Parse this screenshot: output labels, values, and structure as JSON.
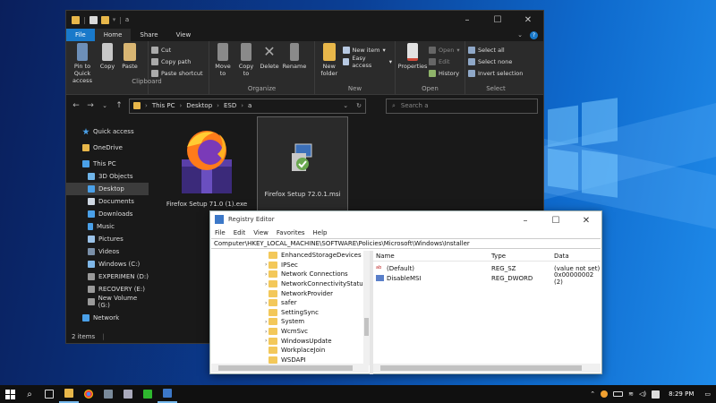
{
  "explorer": {
    "tabs": [
      "File",
      "Home",
      "Share",
      "View"
    ],
    "ribbon": {
      "clipboard": {
        "pin": "Pin to Quick access",
        "copy": "Copy",
        "paste": "Paste",
        "cut": "Cut",
        "copy_path": "Copy path",
        "paste_shortcut": "Paste shortcut",
        "label": "Clipboard"
      },
      "organize": {
        "move": "Move to",
        "copy_to": "Copy to",
        "delete": "Delete",
        "rename": "Rename",
        "label": "Organize"
      },
      "new": {
        "new_folder": "New folder",
        "new_item": "New item",
        "easy_access": "Easy access",
        "label": "New"
      },
      "open": {
        "properties": "Properties",
        "open": "Open",
        "edit": "Edit",
        "history": "History",
        "label": "Open"
      },
      "select": {
        "select_all": "Select all",
        "select_none": "Select none",
        "invert": "Invert selection",
        "label": "Select"
      }
    },
    "breadcrumb": [
      "This PC",
      "Desktop",
      "ESD",
      "a"
    ],
    "search_placeholder": "Search a",
    "nav": {
      "quick_access": "Quick access",
      "onedrive": "OneDrive",
      "this_pc": "This PC",
      "objects3d": "3D Objects",
      "desktop": "Desktop",
      "documents": "Documents",
      "downloads": "Downloads",
      "music": "Music",
      "pictures": "Pictures",
      "videos": "Videos",
      "windows_c": "Windows (C:)",
      "experimen_d": "EXPERIMEN (D:)",
      "recovery_e": "RECOVERY (E:)",
      "newvol_g": "New Volume (G:)",
      "network": "Network"
    },
    "files": [
      {
        "name": "Firefox Setup 71.0 (1).exe"
      },
      {
        "name": "Firefox Setup 72.0.1.msi"
      }
    ],
    "status": "2 items"
  },
  "regedit": {
    "title": "Registry Editor",
    "menu": [
      "File",
      "Edit",
      "View",
      "Favorites",
      "Help"
    ],
    "path": "Computer\\HKEY_LOCAL_MACHINE\\SOFTWARE\\Policies\\Microsoft\\Windows\\Installer",
    "tree": [
      "EnhancedStorageDevices",
      "IPSec",
      "Network Connections",
      "NetworkConnectivityStatu",
      "NetworkProvider",
      "safer",
      "SettingSync",
      "System",
      "WcmSvc",
      "WindowsUpdate",
      "WorkplaceJoin",
      "WSDAPI"
    ],
    "columns": {
      "name": "Name",
      "type": "Type",
      "data": "Data"
    },
    "values": [
      {
        "name": "(Default)",
        "type": "REG_SZ",
        "data": "(value not set)"
      },
      {
        "name": "DisableMSI",
        "type": "REG_DWORD",
        "data": "0x00000002 (2)"
      }
    ]
  },
  "taskbar": {
    "time": "8:29 PM"
  },
  "colors": {
    "accent": "#1979ca",
    "explorer_bg": "#191919",
    "ribbon_bg": "#2b2b2b",
    "folder": "#f3c85a"
  }
}
